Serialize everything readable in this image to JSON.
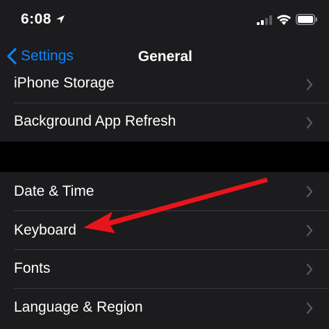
{
  "status_bar": {
    "time": "6:08",
    "location_icon": "location-arrow-icon",
    "signal_icon": "cellular-signal-icon",
    "wifi_icon": "wifi-icon",
    "battery_icon": "battery-icon"
  },
  "nav": {
    "back_label": "Settings",
    "title": "General"
  },
  "group1": {
    "rows": [
      {
        "label": "iPhone Storage"
      },
      {
        "label": "Background App Refresh"
      }
    ]
  },
  "group2": {
    "rows": [
      {
        "label": "Date & Time"
      },
      {
        "label": "Keyboard"
      },
      {
        "label": "Fonts"
      },
      {
        "label": "Language & Region"
      }
    ]
  },
  "colors": {
    "accent": "#0a84ff",
    "background": "#1c1c1e",
    "separator": "#3a3a3c",
    "annotation_arrow": "#e8141c"
  }
}
